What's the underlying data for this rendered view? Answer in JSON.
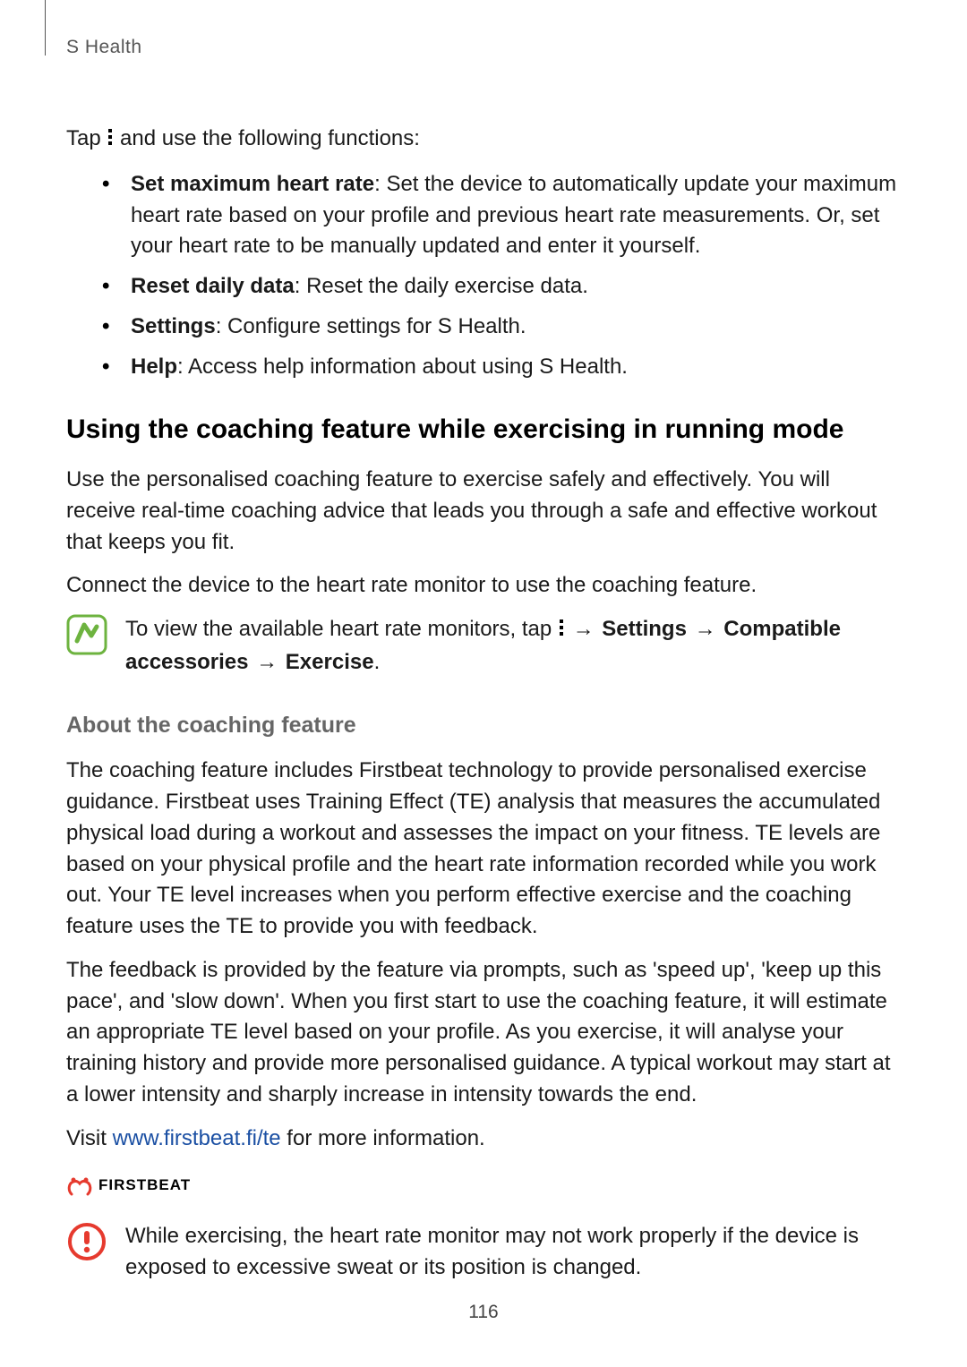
{
  "header": {
    "section": "S Health"
  },
  "page_number": "116",
  "intro": {
    "pre": "Tap ",
    "post": " and use the following functions:"
  },
  "bullets": [
    {
      "term": "Set maximum heart rate",
      "desc": ": Set the device to automatically update your maximum heart rate based on your profile and previous heart rate measurements. Or, set your heart rate to be manually updated and enter it yourself."
    },
    {
      "term": "Reset daily data",
      "desc": ": Reset the daily exercise data."
    },
    {
      "term": "Settings",
      "desc": ": Configure settings for S Health."
    },
    {
      "term": "Help",
      "desc": ": Access help information about using S Health."
    }
  ],
  "h2": "Using the coaching feature while exercising in running mode",
  "para1": "Use the personalised coaching feature to exercise safely and effectively. You will receive real-time coaching advice that leads you through a safe and effective workout that keeps you fit.",
  "para2": "Connect the device to the heart rate monitor to use the coaching feature.",
  "note1": {
    "pre": "To view the available heart rate monitors, tap ",
    "arrow": " → ",
    "settings": "Settings",
    "compat": "Compatible accessories",
    "exercise": "Exercise",
    "period": "."
  },
  "h3": "About the coaching feature",
  "para3": "The coaching feature includes Firstbeat technology to provide personalised exercise guidance. Firstbeat uses Training Effect (TE) analysis that measures the accumulated physical load during a workout and assesses the impact on your fitness. TE levels are based on your physical profile and the heart rate information recorded while you work out. Your TE level increases when you perform effective exercise and the coaching feature uses the TE to provide you with feedback.",
  "para4": "The feedback is provided by the feature via prompts, such as 'speed up', 'keep up this pace', and 'slow down'. When you first start to use the coaching feature, it will estimate an appropriate TE level based on your profile. As you exercise, it will analyse your training history and provide more personalised guidance. A typical workout may start at a lower intensity and sharply increase in intensity towards the end.",
  "visit": {
    "pre": "Visit ",
    "link": "www.firstbeat.fi/te",
    "post": " for more information."
  },
  "firstbeat_brand": "FIRSTBEAT",
  "warning": "While exercising, the heart rate monitor may not work properly if the device is exposed to excessive sweat or its position is changed."
}
